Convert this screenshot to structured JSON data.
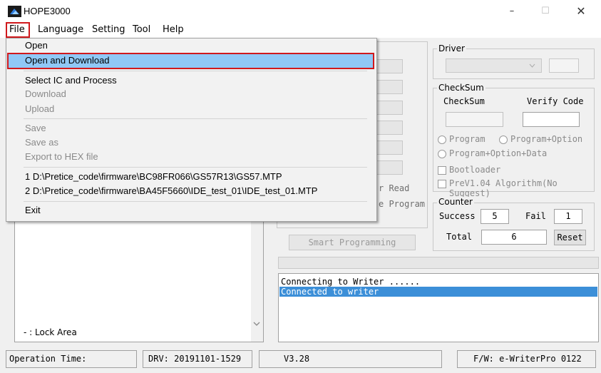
{
  "app": {
    "title": "HOPE3000"
  },
  "window_controls": {
    "minimize": "–",
    "maximize": "☐",
    "close": "✕"
  },
  "menubar": [
    {
      "label": "File"
    },
    {
      "label": "Language"
    },
    {
      "label": "Setting"
    },
    {
      "label": "Tool"
    },
    {
      "label": "Help"
    }
  ],
  "file_menu": {
    "items": [
      {
        "label": "Open",
        "enabled": true
      },
      {
        "label": "Open and Download",
        "enabled": true,
        "highlighted": true
      },
      {
        "label": "Select IC and Process",
        "enabled": true
      },
      {
        "label": "Download",
        "enabled": false
      },
      {
        "label": "Upload",
        "enabled": false
      },
      {
        "label": "Save",
        "enabled": false
      },
      {
        "label": "Save as",
        "enabled": false
      },
      {
        "label": "Export to HEX file",
        "enabled": false
      },
      {
        "label": "1 D:\\Pretice_code\\firmware\\BC98FR066\\GS57R13\\GS57.MTP",
        "enabled": true
      },
      {
        "label": "2 D:\\Pretice_code\\firmware\\BA45F5660\\IDE_test_01\\IDE_test_01.MTP",
        "enabled": true
      },
      {
        "label": "Exit",
        "enabled": true
      }
    ]
  },
  "left_panel": {
    "lock_area_label": "- : Lock Area"
  },
  "middle": {
    "partial_option_1": "r Read",
    "partial_option_2": "e Program",
    "smart_programming": "Smart Programming"
  },
  "driver": {
    "legend": "Driver"
  },
  "checksum": {
    "legend": "CheckSum",
    "checksum_label": "CheckSum",
    "verify_code_label": "Verify Code",
    "radio_program": "Program",
    "radio_program_option": "Program+Option",
    "radio_program_option_data": "Program+Option+Data",
    "check_bootloader": "Bootloader",
    "check_prev104": "PreV1.04 Algorithm(No Suggest)"
  },
  "counter": {
    "legend": "Counter",
    "success_label": "Success",
    "success_value": "5",
    "fail_label": "Fail",
    "fail_value": "1",
    "total_label": "Total",
    "total_value": "6",
    "reset": "Reset"
  },
  "log": {
    "lines": [
      {
        "text": "Connecting to Writer ......",
        "selected": false
      },
      {
        "text": "Connected to writer",
        "selected": true
      }
    ]
  },
  "statusbar": {
    "operation_time": "Operation Time:",
    "drv": "DRV: 20191101-1529",
    "version": "V3.28",
    "fw": "F/W: e-WriterPro 0122"
  },
  "colors": {
    "highlight": "#90c8f6",
    "selection": "#3c8fd8",
    "focus_outline": "#d0191d"
  }
}
